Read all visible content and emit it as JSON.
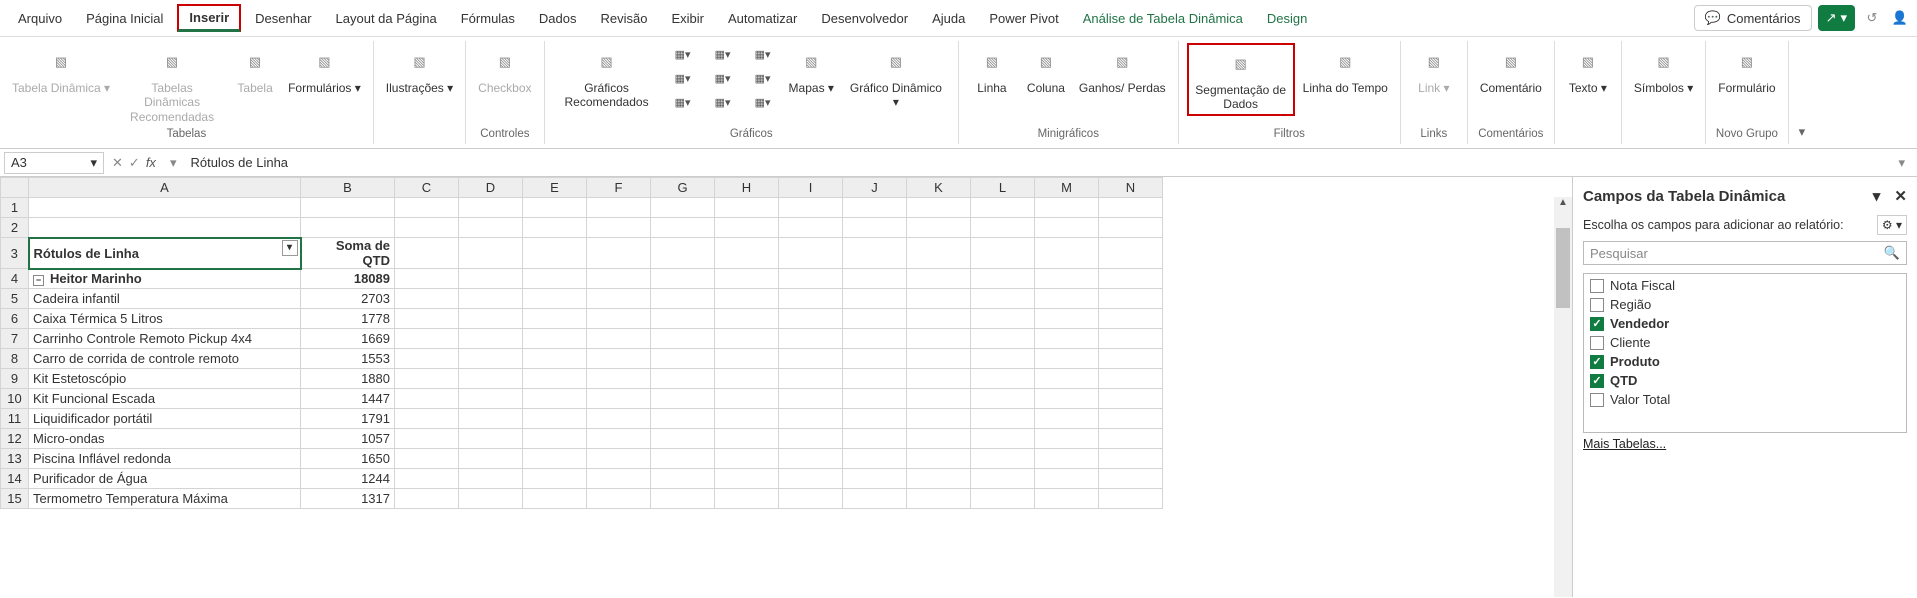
{
  "tabs": [
    "Arquivo",
    "Página Inicial",
    "Inserir",
    "Desenhar",
    "Layout da Página",
    "Fórmulas",
    "Dados",
    "Revisão",
    "Exibir",
    "Automatizar",
    "Desenvolvedor",
    "Ajuda",
    "Power Pivot",
    "Análise de Tabela Dinâmica",
    "Design"
  ],
  "active_tab_index": 2,
  "comments_btn": "Comentários",
  "ribbon": {
    "groups": [
      {
        "label": "Tabelas",
        "items": [
          {
            "label": "Tabela Dinâmica ▾",
            "name": "pivot-table-button",
            "disabled": true
          },
          {
            "label": "Tabelas Dinâmicas Recomendadas",
            "name": "recommended-pivot-tables-button",
            "disabled": true
          },
          {
            "label": "Tabela",
            "name": "table-button",
            "disabled": true
          },
          {
            "label": "Formulários ▾",
            "name": "forms-button"
          }
        ]
      },
      {
        "label": "",
        "items": [
          {
            "label": "Ilustrações ▾",
            "name": "illustrations-button"
          }
        ]
      },
      {
        "label": "Controles",
        "items": [
          {
            "label": "Checkbox",
            "name": "checkbox-button",
            "disabled": true
          }
        ]
      },
      {
        "label": "Gráficos",
        "items": [
          {
            "label": "Gráficos Recomendados",
            "name": "recommended-charts-button"
          },
          {
            "label": "",
            "name": "charts-gallery",
            "gallery": true
          },
          {
            "label": "Mapas ▾",
            "name": "maps-button"
          },
          {
            "label": "Gráfico Dinâmico ▾",
            "name": "pivot-chart-button"
          }
        ]
      },
      {
        "label": "Minigráficos",
        "items": [
          {
            "label": "Linha",
            "name": "sparkline-line-button"
          },
          {
            "label": "Coluna",
            "name": "sparkline-column-button"
          },
          {
            "label": "Ganhos/ Perdas",
            "name": "sparkline-winloss-button"
          }
        ]
      },
      {
        "label": "Filtros",
        "items": [
          {
            "label": "Segmentação de Dados",
            "name": "slicer-button",
            "highlight": true
          },
          {
            "label": "Linha do Tempo",
            "name": "timeline-button"
          }
        ]
      },
      {
        "label": "Links",
        "items": [
          {
            "label": "Link ▾",
            "name": "link-button",
            "disabled": true
          }
        ]
      },
      {
        "label": "Comentários",
        "items": [
          {
            "label": "Comentário",
            "name": "comment-button"
          }
        ]
      },
      {
        "label": "",
        "items": [
          {
            "label": "Texto ▾",
            "name": "text-button"
          }
        ]
      },
      {
        "label": "",
        "items": [
          {
            "label": "Símbolos ▾",
            "name": "symbols-button"
          }
        ]
      },
      {
        "label": "Novo Grupo",
        "items": [
          {
            "label": "Formulário",
            "name": "form-button"
          }
        ]
      }
    ]
  },
  "name_box": "A3",
  "formula_value": "Rótulos de Linha",
  "columns": [
    "A",
    "B",
    "C",
    "D",
    "E",
    "F",
    "G",
    "H",
    "I",
    "J",
    "K",
    "L",
    "M",
    "N"
  ],
  "rows": [
    {
      "r": 1,
      "a": "",
      "b": ""
    },
    {
      "r": 2,
      "a": "",
      "b": ""
    },
    {
      "r": 3,
      "a": "Rótulos de Linha",
      "b": "Soma de QTD",
      "sel": true,
      "b_bold": true
    },
    {
      "r": 4,
      "a": "Heitor Marinho",
      "b": "18089",
      "collapse": true,
      "a_bold": true,
      "b_bold": true
    },
    {
      "r": 5,
      "a": "Cadeira infantil",
      "b": "2703",
      "indent": 2
    },
    {
      "r": 6,
      "a": "Caixa Térmica 5 Litros",
      "b": "1778",
      "indent": 2
    },
    {
      "r": 7,
      "a": "Carrinho Controle Remoto Pickup 4x4",
      "b": "1669",
      "indent": 2
    },
    {
      "r": 8,
      "a": "Carro de corrida de controle remoto",
      "b": "1553",
      "indent": 2
    },
    {
      "r": 9,
      "a": "Kit Estetoscópio",
      "b": "1880",
      "indent": 2
    },
    {
      "r": 10,
      "a": "Kit Funcional Escada",
      "b": "1447",
      "indent": 2
    },
    {
      "r": 11,
      "a": "Liquidificador portátil",
      "b": "1791",
      "indent": 2
    },
    {
      "r": 12,
      "a": "Micro-ondas",
      "b": "1057",
      "indent": 2
    },
    {
      "r": 13,
      "a": "Piscina Inflável redonda",
      "b": "1650",
      "indent": 2
    },
    {
      "r": 14,
      "a": "Purificador de Água",
      "b": "1244",
      "indent": 2
    },
    {
      "r": 15,
      "a": "Termometro Temperatura Máxima",
      "b": "1317",
      "indent": 2
    }
  ],
  "pane": {
    "title": "Campos da Tabela Dinâmica",
    "hint": "Escolha os campos para adicionar ao relatório:",
    "search_ph": "Pesquisar",
    "fields": [
      {
        "label": "Nota Fiscal",
        "checked": false
      },
      {
        "label": "Região",
        "checked": false
      },
      {
        "label": "Vendedor",
        "checked": true
      },
      {
        "label": "Cliente",
        "checked": false
      },
      {
        "label": "Produto",
        "checked": true
      },
      {
        "label": "QTD",
        "checked": true
      },
      {
        "label": "Valor Total",
        "checked": false
      }
    ],
    "more": "Mais Tabelas..."
  },
  "chart_data": {
    "type": "table",
    "title": "Soma de QTD por Produto (Heitor Marinho)",
    "columns": [
      "Rótulos de Linha",
      "Soma de QTD"
    ],
    "rows": [
      [
        "Heitor Marinho",
        18089
      ],
      [
        "Cadeira infantil",
        2703
      ],
      [
        "Caixa Térmica 5 Litros",
        1778
      ],
      [
        "Carrinho Controle Remoto Pickup 4x4",
        1669
      ],
      [
        "Carro de corrida de controle remoto",
        1553
      ],
      [
        "Kit Estetoscópio",
        1880
      ],
      [
        "Kit Funcional Escada",
        1447
      ],
      [
        "Liquidificador portátil",
        1791
      ],
      [
        "Micro-ondas",
        1057
      ],
      [
        "Piscina Inflável redonda",
        1650
      ],
      [
        "Purificador de Água",
        1244
      ],
      [
        "Termometro Temperatura Máxima",
        1317
      ]
    ]
  }
}
